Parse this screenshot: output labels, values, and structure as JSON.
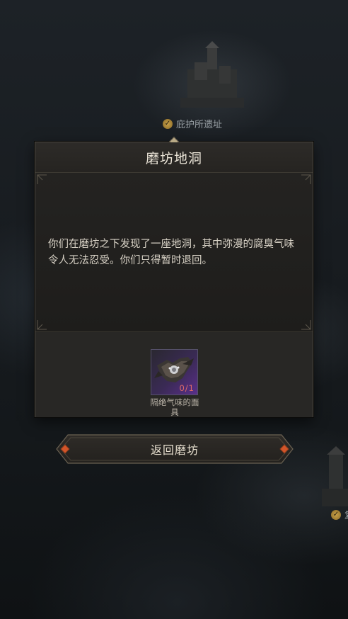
{
  "map": {
    "location_label": "庇护所遗址",
    "right_edge_label": "复"
  },
  "dialog": {
    "title": "磨坊地洞",
    "story": "你们在磨坊之下发现了一座地洞，其中弥漫的腐臭气味令人无法忍受。你们只得暂时退回。",
    "item": {
      "name": "隔绝气味的面具",
      "count": "0/1",
      "icon": "mask-icon"
    }
  },
  "actions": {
    "return_label": "返回磨坊"
  },
  "colors": {
    "accent_gold": "#c8a14a",
    "button_gem": "#d2552a",
    "item_rarity_purple": "#5a2f8a",
    "count_red": "#e06a6a"
  }
}
